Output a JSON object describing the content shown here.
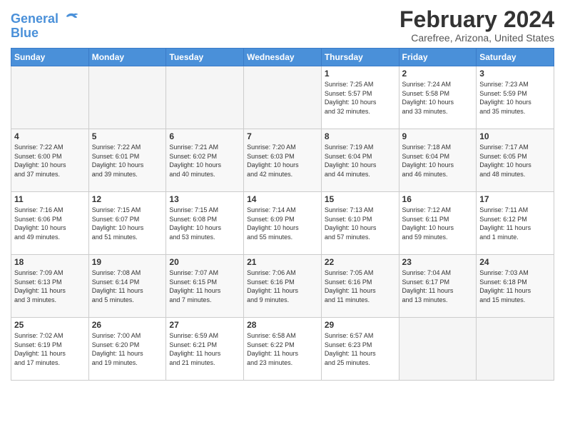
{
  "header": {
    "logo_line1": "General",
    "logo_line2": "Blue",
    "title": "February 2024",
    "subtitle": "Carefree, Arizona, United States"
  },
  "weekdays": [
    "Sunday",
    "Monday",
    "Tuesday",
    "Wednesday",
    "Thursday",
    "Friday",
    "Saturday"
  ],
  "weeks": [
    [
      {
        "day": "",
        "info": ""
      },
      {
        "day": "",
        "info": ""
      },
      {
        "day": "",
        "info": ""
      },
      {
        "day": "",
        "info": ""
      },
      {
        "day": "1",
        "info": "Sunrise: 7:25 AM\nSunset: 5:57 PM\nDaylight: 10 hours\nand 32 minutes."
      },
      {
        "day": "2",
        "info": "Sunrise: 7:24 AM\nSunset: 5:58 PM\nDaylight: 10 hours\nand 33 minutes."
      },
      {
        "day": "3",
        "info": "Sunrise: 7:23 AM\nSunset: 5:59 PM\nDaylight: 10 hours\nand 35 minutes."
      }
    ],
    [
      {
        "day": "4",
        "info": "Sunrise: 7:22 AM\nSunset: 6:00 PM\nDaylight: 10 hours\nand 37 minutes."
      },
      {
        "day": "5",
        "info": "Sunrise: 7:22 AM\nSunset: 6:01 PM\nDaylight: 10 hours\nand 39 minutes."
      },
      {
        "day": "6",
        "info": "Sunrise: 7:21 AM\nSunset: 6:02 PM\nDaylight: 10 hours\nand 40 minutes."
      },
      {
        "day": "7",
        "info": "Sunrise: 7:20 AM\nSunset: 6:03 PM\nDaylight: 10 hours\nand 42 minutes."
      },
      {
        "day": "8",
        "info": "Sunrise: 7:19 AM\nSunset: 6:04 PM\nDaylight: 10 hours\nand 44 minutes."
      },
      {
        "day": "9",
        "info": "Sunrise: 7:18 AM\nSunset: 6:04 PM\nDaylight: 10 hours\nand 46 minutes."
      },
      {
        "day": "10",
        "info": "Sunrise: 7:17 AM\nSunset: 6:05 PM\nDaylight: 10 hours\nand 48 minutes."
      }
    ],
    [
      {
        "day": "11",
        "info": "Sunrise: 7:16 AM\nSunset: 6:06 PM\nDaylight: 10 hours\nand 49 minutes."
      },
      {
        "day": "12",
        "info": "Sunrise: 7:15 AM\nSunset: 6:07 PM\nDaylight: 10 hours\nand 51 minutes."
      },
      {
        "day": "13",
        "info": "Sunrise: 7:15 AM\nSunset: 6:08 PM\nDaylight: 10 hours\nand 53 minutes."
      },
      {
        "day": "14",
        "info": "Sunrise: 7:14 AM\nSunset: 6:09 PM\nDaylight: 10 hours\nand 55 minutes."
      },
      {
        "day": "15",
        "info": "Sunrise: 7:13 AM\nSunset: 6:10 PM\nDaylight: 10 hours\nand 57 minutes."
      },
      {
        "day": "16",
        "info": "Sunrise: 7:12 AM\nSunset: 6:11 PM\nDaylight: 10 hours\nand 59 minutes."
      },
      {
        "day": "17",
        "info": "Sunrise: 7:11 AM\nSunset: 6:12 PM\nDaylight: 11 hours\nand 1 minute."
      }
    ],
    [
      {
        "day": "18",
        "info": "Sunrise: 7:09 AM\nSunset: 6:13 PM\nDaylight: 11 hours\nand 3 minutes."
      },
      {
        "day": "19",
        "info": "Sunrise: 7:08 AM\nSunset: 6:14 PM\nDaylight: 11 hours\nand 5 minutes."
      },
      {
        "day": "20",
        "info": "Sunrise: 7:07 AM\nSunset: 6:15 PM\nDaylight: 11 hours\nand 7 minutes."
      },
      {
        "day": "21",
        "info": "Sunrise: 7:06 AM\nSunset: 6:16 PM\nDaylight: 11 hours\nand 9 minutes."
      },
      {
        "day": "22",
        "info": "Sunrise: 7:05 AM\nSunset: 6:16 PM\nDaylight: 11 hours\nand 11 minutes."
      },
      {
        "day": "23",
        "info": "Sunrise: 7:04 AM\nSunset: 6:17 PM\nDaylight: 11 hours\nand 13 minutes."
      },
      {
        "day": "24",
        "info": "Sunrise: 7:03 AM\nSunset: 6:18 PM\nDaylight: 11 hours\nand 15 minutes."
      }
    ],
    [
      {
        "day": "25",
        "info": "Sunrise: 7:02 AM\nSunset: 6:19 PM\nDaylight: 11 hours\nand 17 minutes."
      },
      {
        "day": "26",
        "info": "Sunrise: 7:00 AM\nSunset: 6:20 PM\nDaylight: 11 hours\nand 19 minutes."
      },
      {
        "day": "27",
        "info": "Sunrise: 6:59 AM\nSunset: 6:21 PM\nDaylight: 11 hours\nand 21 minutes."
      },
      {
        "day": "28",
        "info": "Sunrise: 6:58 AM\nSunset: 6:22 PM\nDaylight: 11 hours\nand 23 minutes."
      },
      {
        "day": "29",
        "info": "Sunrise: 6:57 AM\nSunset: 6:23 PM\nDaylight: 11 hours\nand 25 minutes."
      },
      {
        "day": "",
        "info": ""
      },
      {
        "day": "",
        "info": ""
      }
    ]
  ]
}
